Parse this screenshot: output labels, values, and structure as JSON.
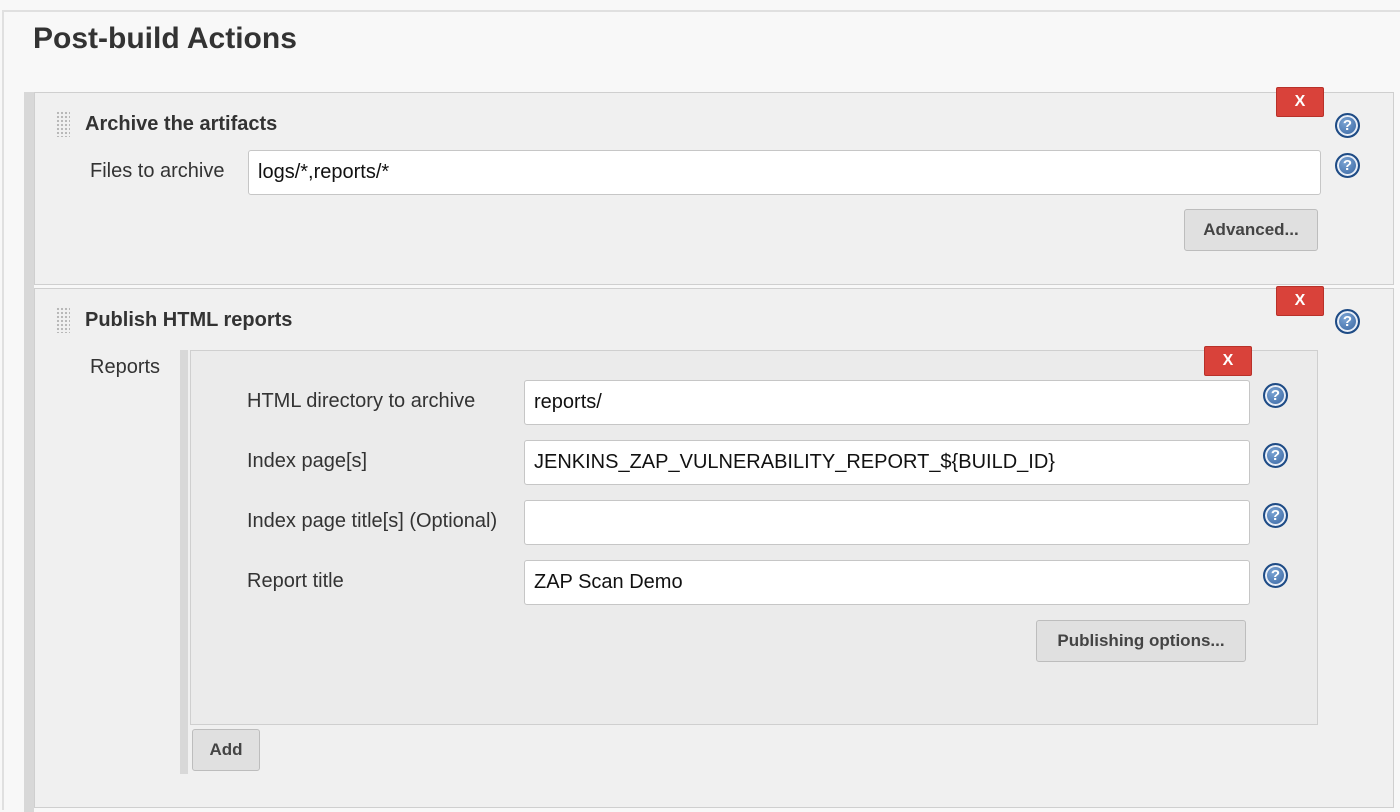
{
  "section": {
    "title": "Post-build Actions"
  },
  "archive_artifacts": {
    "header": "Archive the artifacts",
    "delete_label": "X",
    "files_label": "Files to archive",
    "files_value": "logs/*,reports/*",
    "advanced_label": "Advanced..."
  },
  "publish_html": {
    "header": "Publish HTML reports",
    "delete_label": "X",
    "reports_label": "Reports",
    "entry": {
      "delete_label": "X",
      "html_dir_label": "HTML directory to archive",
      "html_dir_value": "reports/",
      "index_pages_label": "Index page[s]",
      "index_pages_value": "JENKINS_ZAP_VULNERABILITY_REPORT_${BUILD_ID}",
      "index_titles_label": "Index page title[s] (Optional)",
      "index_titles_value": "",
      "report_title_label": "Report title",
      "report_title_value": "ZAP Scan Demo",
      "publishing_options_label": "Publishing options..."
    },
    "add_label": "Add"
  },
  "icons": {
    "help": "question-mark",
    "help_glyph": "?",
    "delete": "x-mark",
    "drag": "drag-handle"
  },
  "colors": {
    "delete_red": "#d9423a",
    "help_blue": "#2f5d9a",
    "panel_bg": "#f0f0f0"
  }
}
